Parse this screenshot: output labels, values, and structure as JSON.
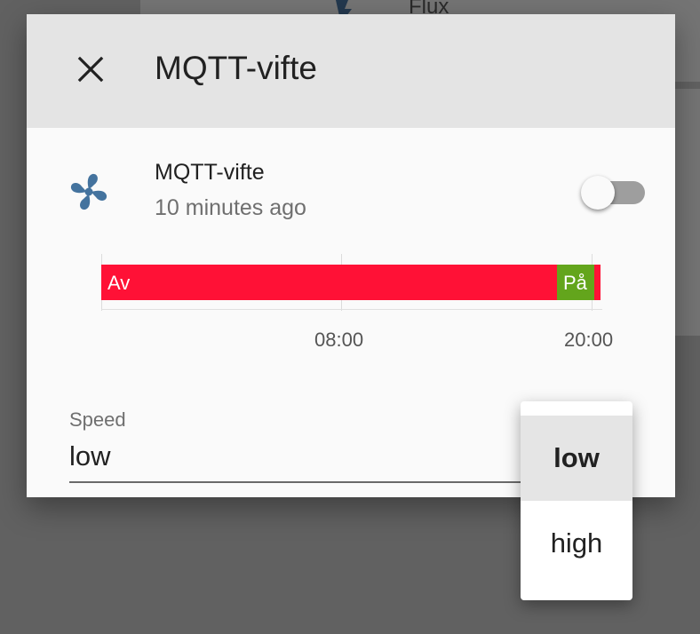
{
  "background": {
    "card_title": "Flux",
    "icon": "lightning-icon"
  },
  "dialog": {
    "title": "MQTT-vifte",
    "close_icon": "close-icon"
  },
  "entity": {
    "icon": "fan-icon",
    "icon_color": "#44739e",
    "name": "MQTT-vifte",
    "last_changed": "10 minutes ago",
    "toggle_state": "off"
  },
  "history": {
    "segments": [
      {
        "label": "Av",
        "color": "#ff1136",
        "fraction": 0.913
      },
      {
        "label": "På",
        "color": "#63a51c",
        "fraction": 0.075
      },
      {
        "label": "",
        "color": "#ff1136",
        "fraction": 0.012
      }
    ],
    "ticks": [
      "08:00",
      "20:00"
    ]
  },
  "speed": {
    "label": "Speed",
    "value": "low",
    "options": [
      "low",
      "high"
    ],
    "selected": "low"
  }
}
